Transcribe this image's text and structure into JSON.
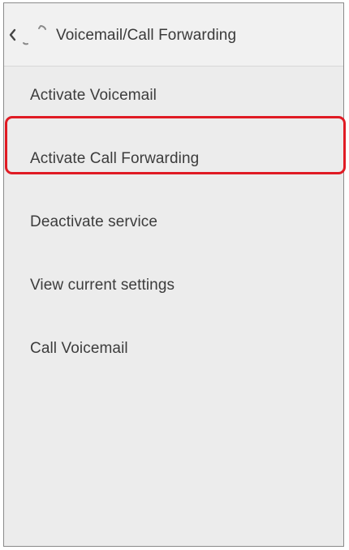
{
  "header": {
    "title": "Voicemail/Call Forwarding",
    "back_icon": "chevron-left-icon",
    "app_icon": "phone-handset-icon"
  },
  "menu": {
    "items": [
      {
        "label": "Activate Voicemail"
      },
      {
        "label": "Activate Call Forwarding",
        "highlighted": true
      },
      {
        "label": "Deactivate service"
      },
      {
        "label": "View current settings"
      },
      {
        "label": "Call Voicemail"
      }
    ]
  },
  "colors": {
    "highlight": "#e01b24",
    "background": "#ececec",
    "text": "#3c3c3c"
  }
}
